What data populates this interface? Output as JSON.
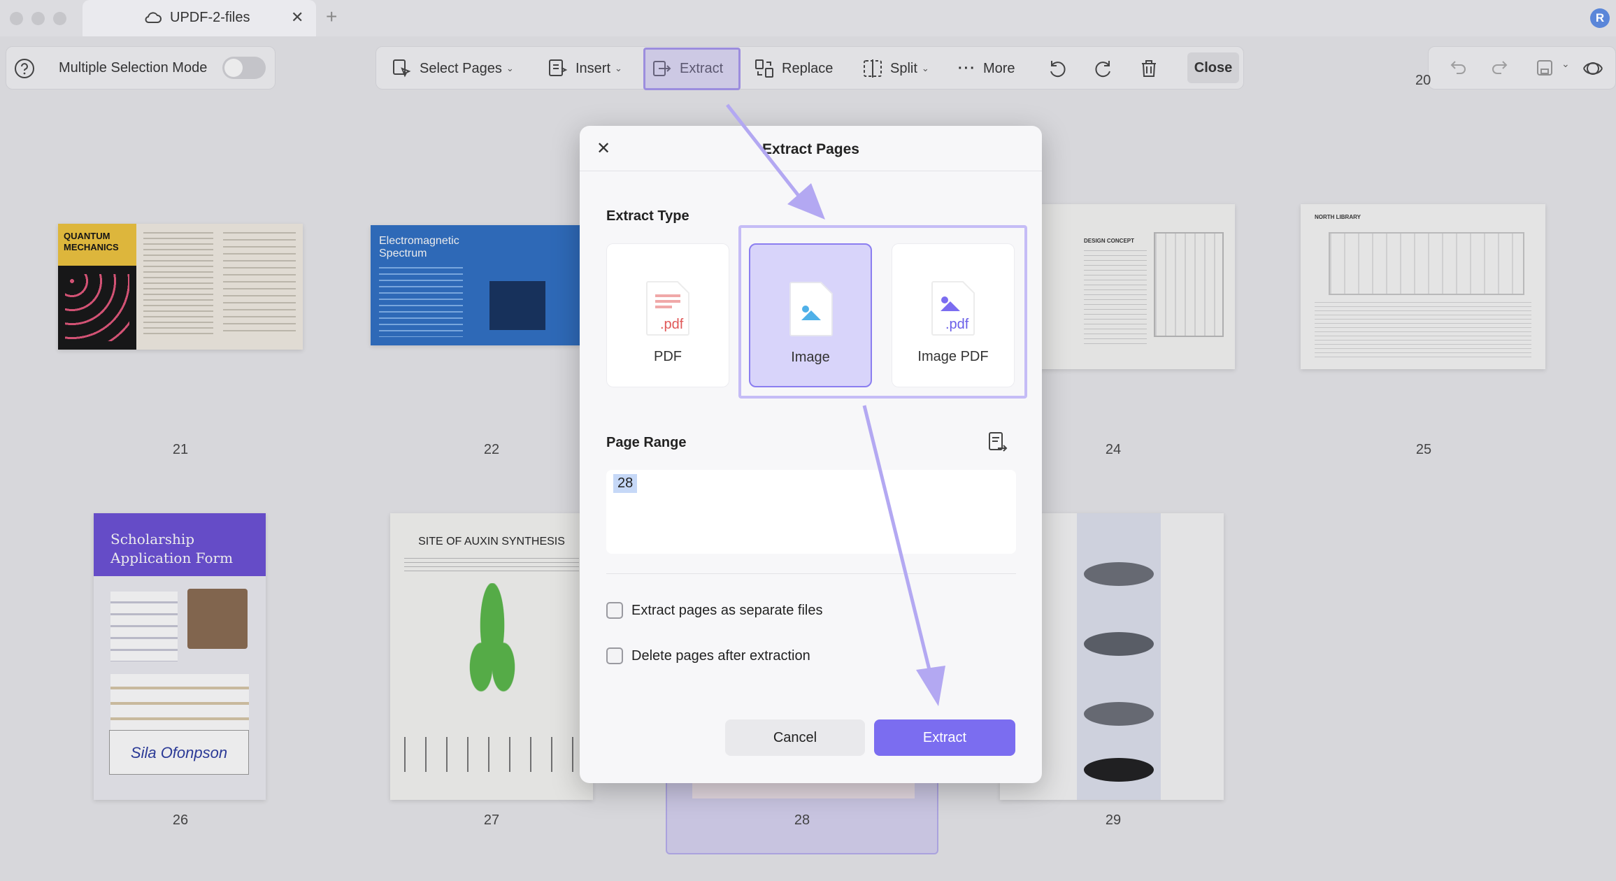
{
  "window": {
    "tab_title": "UPDF-2-files",
    "tab_close": "✕",
    "tab_add": "+",
    "avatar_letter": "R"
  },
  "toolbar": {
    "multi_select_label": "Multiple Selection Mode",
    "select_pages": "Select Pages",
    "insert": "Insert",
    "extract": "Extract",
    "replace": "Replace",
    "split": "Split",
    "more": "More",
    "close": "Close"
  },
  "page_partial_number": "20",
  "pages": [
    {
      "num": "21",
      "title": "QUANTUM MECHANICS"
    },
    {
      "num": "22",
      "title": "Electromagnetic Spectrum"
    },
    {
      "num": "24",
      "title": "DESIGN CONCEPT"
    },
    {
      "num": "25",
      "title": "NORTH LIBRARY"
    },
    {
      "num": "26",
      "title": "Scholarship Application Form",
      "signature": "Sila Ofonpson"
    },
    {
      "num": "27",
      "title": "SITE OF AUXIN SYNTHESIS"
    },
    {
      "num": "28",
      "title": ""
    },
    {
      "num": "29",
      "title": ""
    }
  ],
  "dialog": {
    "title": "Extract Pages",
    "close": "✕",
    "extract_type_label": "Extract Type",
    "types": [
      {
        "label": "PDF",
        "badge": ".pdf"
      },
      {
        "label": "Image",
        "badge": ""
      },
      {
        "label": "Image PDF",
        "badge": ".pdf"
      }
    ],
    "page_range_label": "Page Range",
    "page_range_value": "28",
    "opt_separate": "Extract pages as separate files",
    "opt_delete": "Delete pages after extraction",
    "cancel": "Cancel",
    "extract": "Extract"
  },
  "colors": {
    "accent": "#7b6df0",
    "highlight": "#c5bcf6",
    "selected_card": "#d8d4fa"
  }
}
